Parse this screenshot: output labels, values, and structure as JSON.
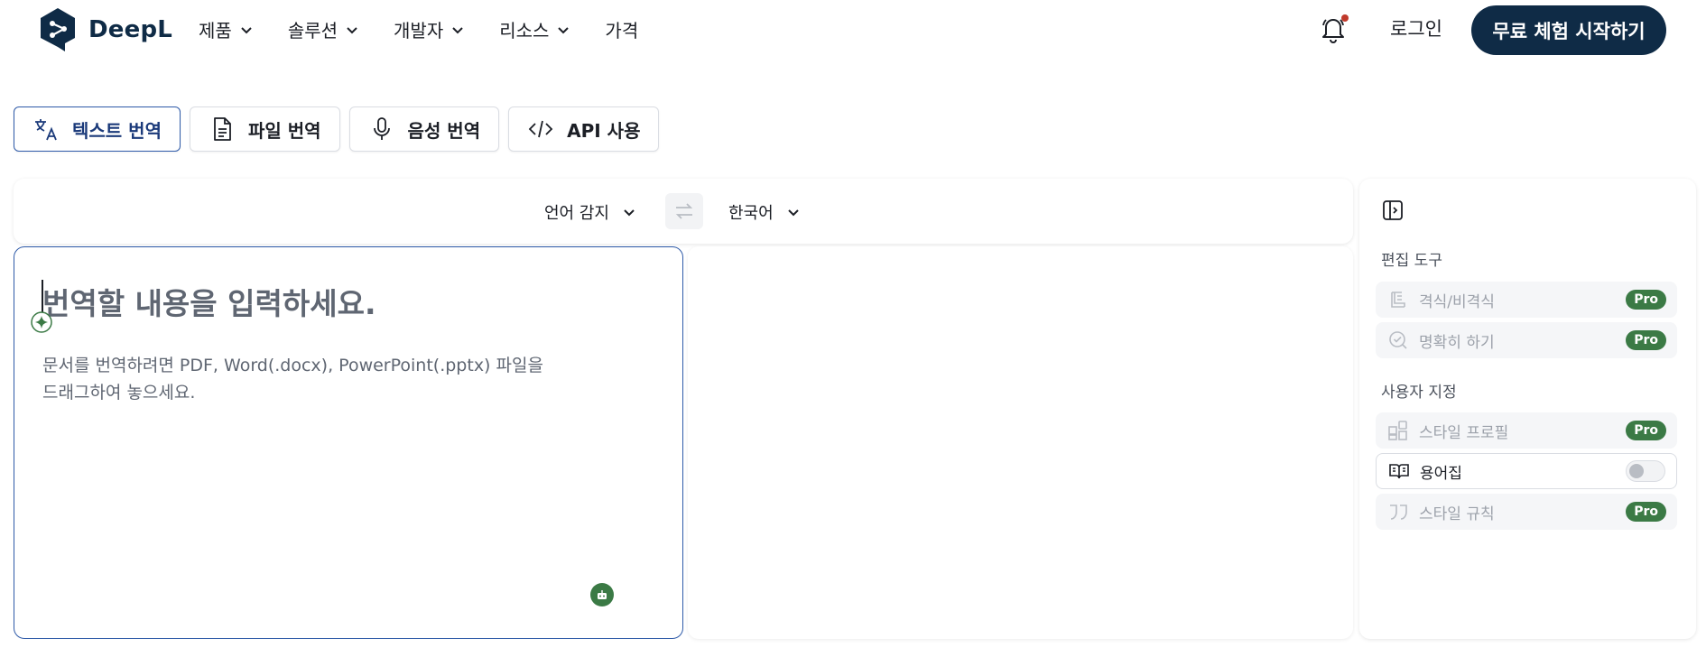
{
  "brand": {
    "name": "DeepL",
    "color": "#0f2b46"
  },
  "nav": {
    "items": [
      {
        "label": "제품"
      },
      {
        "label": "솔루션"
      },
      {
        "label": "개발자"
      },
      {
        "label": "리소스"
      },
      {
        "label": "가격"
      }
    ],
    "login": "로그인",
    "cta": "무료 체험 시작하기"
  },
  "tabs": [
    {
      "label": "텍스트 번역",
      "icon": "translate-icon",
      "active": true
    },
    {
      "label": "파일 번역",
      "icon": "file-icon",
      "active": false
    },
    {
      "label": "음성 번역",
      "icon": "microphone-icon",
      "active": false
    },
    {
      "label": "API 사용",
      "icon": "code-icon",
      "active": false
    }
  ],
  "languages": {
    "source": "언어 감지",
    "target": "한국어"
  },
  "source_panel": {
    "placeholder": "번역할 내용을 입력하세요.",
    "hint_line1": "문서를 번역하려면 PDF, Word(.docx), PowerPoint(.pptx) 파일을",
    "hint_line2": "드래그하여 놓으세요."
  },
  "sidebar": {
    "editing_title": "편집 도구",
    "customize_title": "사용자 지정",
    "rows": [
      {
        "label": "격식/비격식",
        "badge": "Pro",
        "icon": "formality-icon"
      },
      {
        "label": "명확히 하기",
        "badge": "Pro",
        "icon": "check-circle-icon"
      },
      {
        "label": "스타일 프로필",
        "badge": "Pro",
        "icon": "shapes-icon"
      },
      {
        "label": "용어집",
        "badge": "",
        "icon": "book-icon"
      },
      {
        "label": "스타일 규칙",
        "badge": "Pro",
        "icon": "quote-icon"
      }
    ]
  },
  "colors": {
    "accent_blue": "#2e5aa8",
    "pro_green": "#3b7a45",
    "notify_red": "#c0392b"
  }
}
